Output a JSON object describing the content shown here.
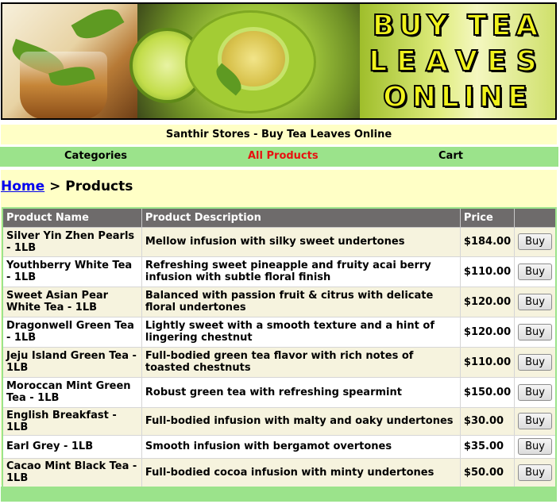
{
  "banner": {
    "line1": "BUY TEA",
    "line2": "LEAVES",
    "line3": "ONLINE"
  },
  "store_title": "Santhir Stores - Buy Tea Leaves Online",
  "nav": {
    "categories": "Categories",
    "all_products": "All Products",
    "cart": "Cart"
  },
  "breadcrumb": {
    "home": "Home",
    "separator": ">",
    "current": "Products"
  },
  "table": {
    "headers": [
      "Product Name",
      "Product Description",
      "Price",
      ""
    ],
    "buy_label": "Buy",
    "rows": [
      {
        "name": "Silver Yin Zhen Pearls - 1LB",
        "desc": "Mellow infusion with silky sweet undertones",
        "price": "$184.00"
      },
      {
        "name": "Youthberry White Tea - 1LB",
        "desc": "Refreshing sweet pineapple and fruity acai berry infusion with subtle floral finish",
        "price": "$110.00"
      },
      {
        "name": "Sweet Asian Pear White Tea - 1LB",
        "desc": "Balanced with passion fruit & citrus with delicate floral undertones",
        "price": "$120.00"
      },
      {
        "name": "Dragonwell Green Tea - 1LB",
        "desc": "Lightly sweet with a smooth texture and a hint of lingering chestnut",
        "price": "$120.00"
      },
      {
        "name": "Jeju Island Green Tea - 1LB",
        "desc": "Full-bodied green tea flavor with rich notes of toasted chestnuts",
        "price": "$110.00"
      },
      {
        "name": "Moroccan Mint Green Tea - 1LB",
        "desc": "Robust green tea with refreshing spearmint",
        "price": "$150.00"
      },
      {
        "name": "English Breakfast - 1LB",
        "desc": "Full-bodied infusion with malty and oaky undertones",
        "price": "$30.00"
      },
      {
        "name": "Earl Grey - 1LB",
        "desc": "Smooth infusion with bergamot overtones",
        "price": "$35.00"
      },
      {
        "name": "Cacao Mint Black Tea - 1LB",
        "desc": "Full-bodied cocoa infusion with minty undertones",
        "price": "$50.00"
      }
    ]
  },
  "colors": {
    "nav_bg": "#9be38b",
    "content_bg": "#ffffc6",
    "header_bg": "#6e6b6b",
    "active_link": "#e81010"
  }
}
